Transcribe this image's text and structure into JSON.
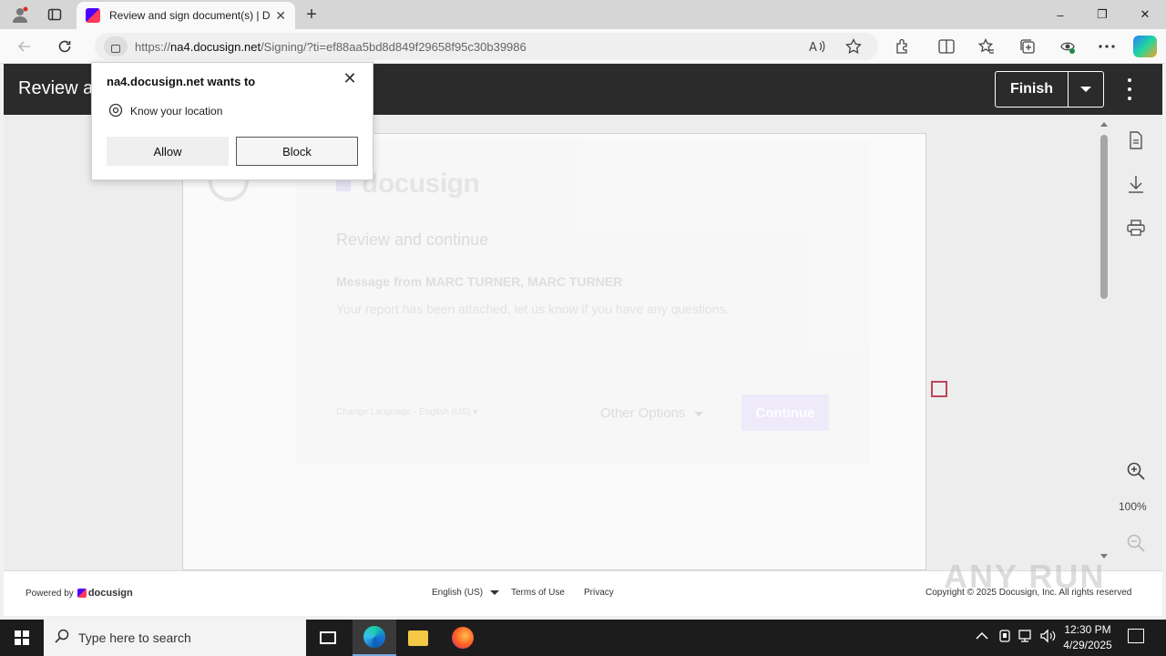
{
  "browser": {
    "tab_title": "Review and sign document(s) | D",
    "tab_close": "✕",
    "new_tab": "+",
    "url_domain": "na4.docusign.net",
    "url_prefix": "https://",
    "url_path": "/Signing/?ti=ef88aa5bd8d849f29658f95c30b39986",
    "window_controls": {
      "minimize": "–",
      "restore": "❐",
      "close": "✕"
    }
  },
  "permission_popup": {
    "title": "na4.docusign.net wants to",
    "close": "✕",
    "permission": "Know your location",
    "allow_label": "Allow",
    "block_label": "Block"
  },
  "header": {
    "title": "Review a",
    "finish_label": "Finish"
  },
  "modal": {
    "logo": "docusign",
    "heading": "Review and continue",
    "message_from": "Message from MARC TURNER, MARC TURNER",
    "message_body": "Your report has been attached, let us know if you have any questions.",
    "change_language": "Change Language - English (US) ▾",
    "other_options": "Other Options",
    "continue_label": "Continue"
  },
  "right_rail": {
    "zoom_level": "100%"
  },
  "footer": {
    "powered_by": "Powered by",
    "brand": "docusign",
    "language": "English (US)",
    "terms": "Terms of Use",
    "privacy": "Privacy",
    "copyright": "Copyright © 2025 Docusign, Inc. All rights reserved"
  },
  "watermark": "ANY RUN",
  "taskbar": {
    "search_placeholder": "Type here to search",
    "time": "12:30 PM",
    "date": "4/29/2025"
  },
  "colors": {
    "header_bg": "#2b2b2b",
    "focus_outline": "#b8324a",
    "taskbar_bg": "#1c1c1c"
  }
}
